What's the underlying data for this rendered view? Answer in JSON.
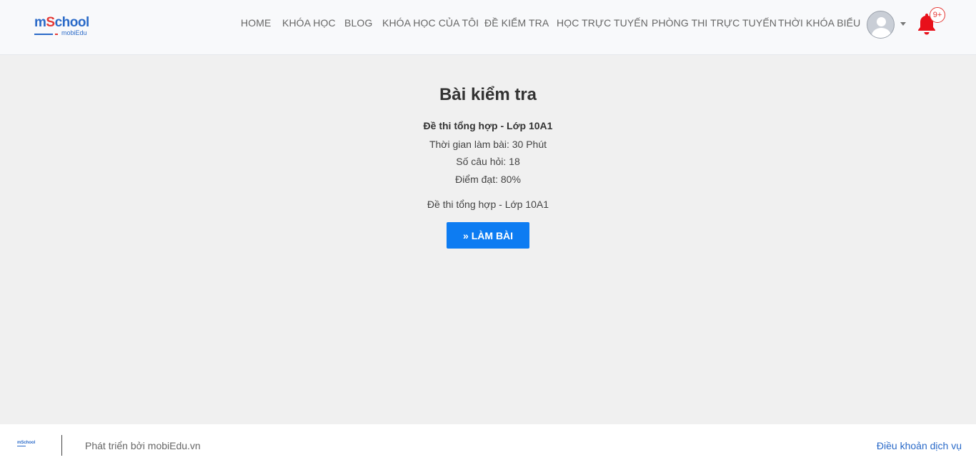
{
  "header": {
    "logo": {
      "main_prefix": "m",
      "main_accent": "S",
      "main_suffix": "chool",
      "sub": "mobiEdu"
    },
    "nav": [
      {
        "label": "HOME"
      },
      {
        "label": "KHÓA HỌC"
      },
      {
        "label": "BLOG"
      },
      {
        "label": "KHÓA HỌC CỦA TÔI"
      },
      {
        "label": "ĐỀ KIỂM TRA"
      },
      {
        "label": "HỌC TRỰC TUYẾN"
      },
      {
        "label": "PHÒNG THI TRỰC TUYẾN"
      },
      {
        "label": "THỜI KHÓA BIỂU"
      }
    ],
    "notifications": {
      "count": "9+",
      "icon": "bell-icon",
      "color": "#e8101a"
    },
    "avatar": {
      "icon": "user-avatar-icon"
    }
  },
  "main": {
    "title": "Bài kiểm tra",
    "exam_name": "Đề thi tổng hợp - Lớp 10A1",
    "duration": "Thời gian làm bài: 30 Phút",
    "question_count": "Số câu hỏi: 18",
    "pass_score": "Điểm đạt: 80%",
    "description": "Đề thi tổng hợp - Lớp 10A1",
    "start_button": {
      "icon": "double-chevron-right-icon",
      "label": "LÀM BÀI",
      "color": "#0d7cf2"
    }
  },
  "footer": {
    "developed_by": "Phát triển bởi mobiEdu.vn",
    "terms_link": "Điều khoản dịch vụ"
  },
  "colors": {
    "brand_blue": "#2a6ac8",
    "brand_red": "#e53935",
    "page_background": "#f0f0f0",
    "header_background": "#f8f9fb"
  }
}
